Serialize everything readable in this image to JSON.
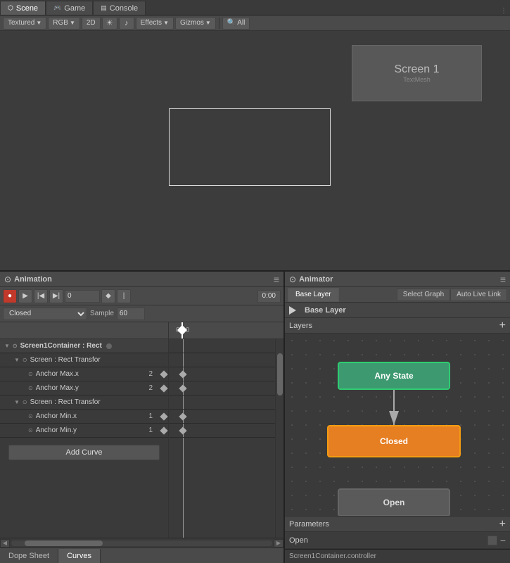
{
  "tabs": {
    "scene": "Scene",
    "game": "Game",
    "console": "Console"
  },
  "toolbar": {
    "textured": "Textured",
    "rgb": "RGB",
    "twod": "2D",
    "effects": "Effects",
    "gizmos": "Gizmos",
    "all": "All"
  },
  "scene": {
    "screen1_title": "Screen 1",
    "screen1_subtitle": "TextMesh"
  },
  "animation_panel": {
    "title": "Animation",
    "record_icon": "●",
    "play_icon": "▶",
    "prev_icon": "⏮",
    "next_icon": "⏭",
    "time_value": "0",
    "add_key_icon": "◆",
    "add_event_icon": "⚡",
    "time_display": "0:00",
    "clip_name": "Closed",
    "sample_label": "Sample",
    "sample_value": "60",
    "tracks": [
      {
        "indent": 0,
        "expand": "▼",
        "name": "Screen1Container : Rect",
        "value": "",
        "has_dot": true
      },
      {
        "indent": 1,
        "expand": "▼",
        "name": "Screen : Rect Transfor",
        "value": "",
        "has_dot": false
      },
      {
        "indent": 2,
        "expand": "",
        "name": "Anchor Max.x",
        "value": "2",
        "has_dot": true
      },
      {
        "indent": 2,
        "expand": "",
        "name": "Anchor Max.y",
        "value": "2",
        "has_dot": true
      },
      {
        "indent": 1,
        "expand": "▼",
        "name": "Screen : Rect Transfor",
        "value": "",
        "has_dot": false
      },
      {
        "indent": 2,
        "expand": "",
        "name": "Anchor Min.x",
        "value": "1",
        "has_dot": true
      },
      {
        "indent": 2,
        "expand": "",
        "name": "Anchor Min.y",
        "value": "1",
        "has_dot": true
      }
    ],
    "add_curve_label": "Add Curve",
    "dope_sheet_tab": "Dope Sheet",
    "curves_tab": "Curves"
  },
  "animator_panel": {
    "title": "Animator",
    "base_layer_tab": "Base Layer",
    "select_graph_btn": "Select Graph",
    "auto_live_link_btn": "Auto Live Link",
    "state_name": "Base Layer",
    "layers_label": "Layers",
    "any_state_label": "Any State",
    "closed_label": "Closed",
    "open_label": "Open",
    "parameters_label": "Parameters",
    "param_open": "Open",
    "controller_file": "Screen1Container.controller"
  }
}
